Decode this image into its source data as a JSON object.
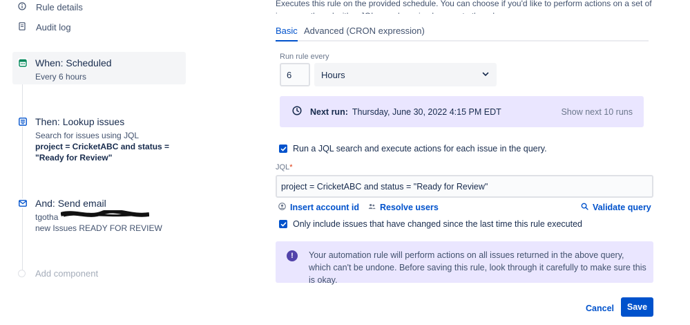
{
  "sidebar": {
    "rule_details": "Rule details",
    "audit_log": "Audit log"
  },
  "components": [
    {
      "title": "When: Scheduled",
      "sub1": "Every 6 hours",
      "icon": "calendar-icon"
    },
    {
      "title": "Then: Lookup issues",
      "sub1": "Search for issues using JQL",
      "sub2": "project = CricketABC and status =",
      "sub3": "\"Ready for Review\"",
      "icon": "lookup-icon"
    },
    {
      "title": "And: Send email",
      "sub1": "tgotha",
      "sub2": "new Issues READY FOR REVIEW",
      "icon": "email-icon"
    }
  ],
  "add_component": "Add component",
  "main": {
    "intro": "Executes this rule on the provided schedule. You can choose if you'd like to perform actions on a set of issues gathered with a JQL search or simply execute the rule.",
    "tabs": [
      "Basic",
      "Advanced (CRON expression)"
    ],
    "run_every_label": "Run rule every",
    "run_every_value": "6",
    "run_every_unit": "Hours",
    "next_run_label": "Next run:",
    "next_run_value": "Thursday, June 30, 2022 4:15 PM EDT",
    "show_next": "Show next 10 runs",
    "jql_checkbox": "Run a JQL search and execute actions for each issue in the query.",
    "jql_label": "JQL",
    "jql_value": "project = CricketABC and status = \"Ready for Review\"",
    "insert_account": "Insert account id",
    "resolve_users": "Resolve users",
    "validate_query": "Validate query",
    "only_changed": "Only include issues that have changed since the last time this rule executed",
    "warning": "Your automation rule will perform actions on all issues returned in the above query, which can't be undone. Before saving this rule, look through it carefully to make sure this is okay.",
    "cancel": "Cancel",
    "save": "Save"
  },
  "colors": {
    "accent": "#0052cc",
    "panel_purple": "#eae6ff",
    "warning_icon": "#5243aa"
  }
}
